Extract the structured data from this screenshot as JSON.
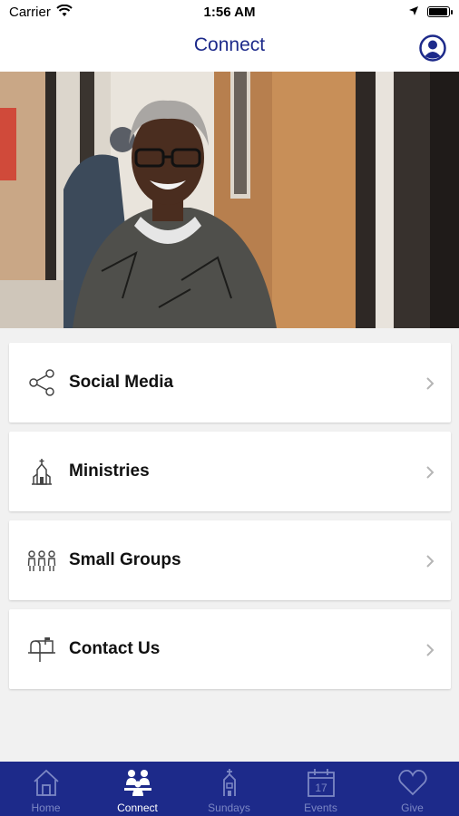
{
  "status_bar": {
    "carrier": "Carrier",
    "time": "1:56 AM"
  },
  "nav": {
    "title": "Connect"
  },
  "menu": [
    {
      "label": "Social Media",
      "icon": "share-icon"
    },
    {
      "label": "Ministries",
      "icon": "church-icon"
    },
    {
      "label": "Small Groups",
      "icon": "group-icon"
    },
    {
      "label": "Contact Us",
      "icon": "mailbox-icon"
    }
  ],
  "tabs": [
    {
      "label": "Home",
      "icon": "home-icon"
    },
    {
      "label": "Connect",
      "icon": "connect-group-icon",
      "active": true
    },
    {
      "label": "Sundays",
      "icon": "steeple-icon"
    },
    {
      "label": "Events",
      "icon": "calendar-icon",
      "day": "17"
    },
    {
      "label": "Give",
      "icon": "heart-icon"
    }
  ],
  "colors": {
    "brand": "#1d2a8a",
    "tab_inactive": "#7c87c4",
    "background": "#f1f1f1"
  }
}
